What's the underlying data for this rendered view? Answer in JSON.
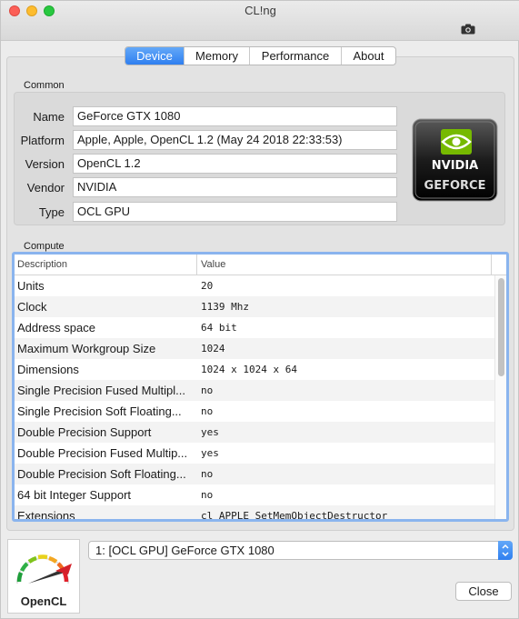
{
  "window": {
    "title": "CL!ng"
  },
  "tabs": [
    {
      "label": "Device",
      "active": true
    },
    {
      "label": "Memory",
      "active": false
    },
    {
      "label": "Performance",
      "active": false
    },
    {
      "label": "About",
      "active": false
    }
  ],
  "common": {
    "label": "Common",
    "fields": [
      {
        "label": "Name",
        "value": "GeForce GTX 1080"
      },
      {
        "label": "Platform",
        "value": "Apple, Apple, OpenCL 1.2 (May 24 2018 22:33:53)"
      },
      {
        "label": "Version",
        "value": "OpenCL 1.2"
      },
      {
        "label": "Vendor",
        "value": "NVIDIA"
      },
      {
        "label": "Type",
        "value": "OCL GPU"
      }
    ],
    "badge": {
      "line1": "NVIDIA",
      "line2": "GEFORCE"
    }
  },
  "compute": {
    "label": "Compute",
    "columns": [
      "Description",
      "Value"
    ],
    "rows": [
      {
        "desc": "Units",
        "value": "20"
      },
      {
        "desc": "Clock",
        "value": "1139 Mhz"
      },
      {
        "desc": "Address space",
        "value": "64 bit"
      },
      {
        "desc": "Maximum Workgroup Size",
        "value": "1024"
      },
      {
        "desc": "Dimensions",
        "value": "1024 x 1024 x 64"
      },
      {
        "desc": "Single Precision Fused Multipl...",
        "value": "no"
      },
      {
        "desc": "Single Precision Soft Floating...",
        "value": "no"
      },
      {
        "desc": "Double Precision Support",
        "value": "yes"
      },
      {
        "desc": "Double Precision Fused Multip...",
        "value": "yes"
      },
      {
        "desc": "Double Precision Soft Floating...",
        "value": "no"
      },
      {
        "desc": "64 bit Integer Support",
        "value": "no"
      },
      {
        "desc": "Extensions",
        "value": "cl_APPLE_SetMemObjectDestructor"
      }
    ]
  },
  "logo": {
    "text": "OpenCL"
  },
  "device_select": {
    "value": "1: [OCL GPU] GeForce GTX 1080"
  },
  "buttons": {
    "close": "Close"
  },
  "colors": {
    "accent": "#2f7ff0",
    "focus_ring": "#8ab4ee"
  }
}
